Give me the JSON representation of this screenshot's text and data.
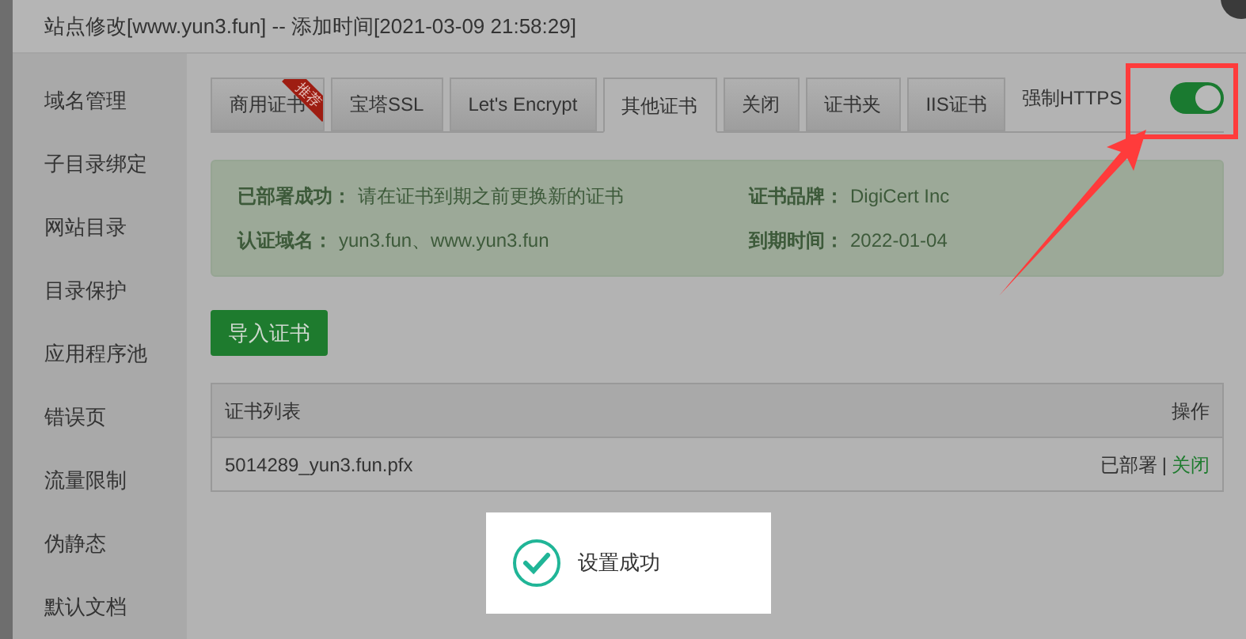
{
  "window": {
    "title": "站点修改[www.yun3.fun] -- 添加时间[2021-03-09 21:58:29]"
  },
  "sidebar": {
    "items": [
      {
        "label": "域名管理",
        "selected": false
      },
      {
        "label": "子目录绑定",
        "selected": false
      },
      {
        "label": "网站目录",
        "selected": false
      },
      {
        "label": "目录保护",
        "selected": false
      },
      {
        "label": "应用程序池",
        "selected": false
      },
      {
        "label": "错误页",
        "selected": false
      },
      {
        "label": "流量限制",
        "selected": false
      },
      {
        "label": "伪静态",
        "selected": false
      },
      {
        "label": "默认文档",
        "selected": false
      }
    ]
  },
  "tabs": [
    {
      "label": "商用证书",
      "selected": false,
      "badge": "推荐"
    },
    {
      "label": "宝塔SSL",
      "selected": false
    },
    {
      "label": "Let's Encrypt",
      "selected": false
    },
    {
      "label": "其他证书",
      "selected": true
    },
    {
      "label": "关闭",
      "selected": false
    },
    {
      "label": "证书夹",
      "selected": false
    },
    {
      "label": "IIS证书",
      "selected": false
    }
  ],
  "force_https": {
    "label": "强制HTTPS",
    "on": true
  },
  "cert_info": [
    {
      "label": "已部署成功：",
      "value": "请在证书到期之前更换新的证书"
    },
    {
      "label": "证书品牌：",
      "value": "DigiCert Inc"
    },
    {
      "label": "认证域名：",
      "value": "yun3.fun、www.yun3.fun"
    },
    {
      "label": "到期时间：",
      "value": "2022-01-04"
    }
  ],
  "import_button": "导入证书",
  "table": {
    "columns": [
      "证书列表",
      "操作"
    ],
    "rows": [
      {
        "name": "5014289_yun3.fun.pfx",
        "status": "已部署",
        "separator": "|",
        "action": "关闭"
      }
    ]
  },
  "toast": {
    "message": "设置成功"
  }
}
